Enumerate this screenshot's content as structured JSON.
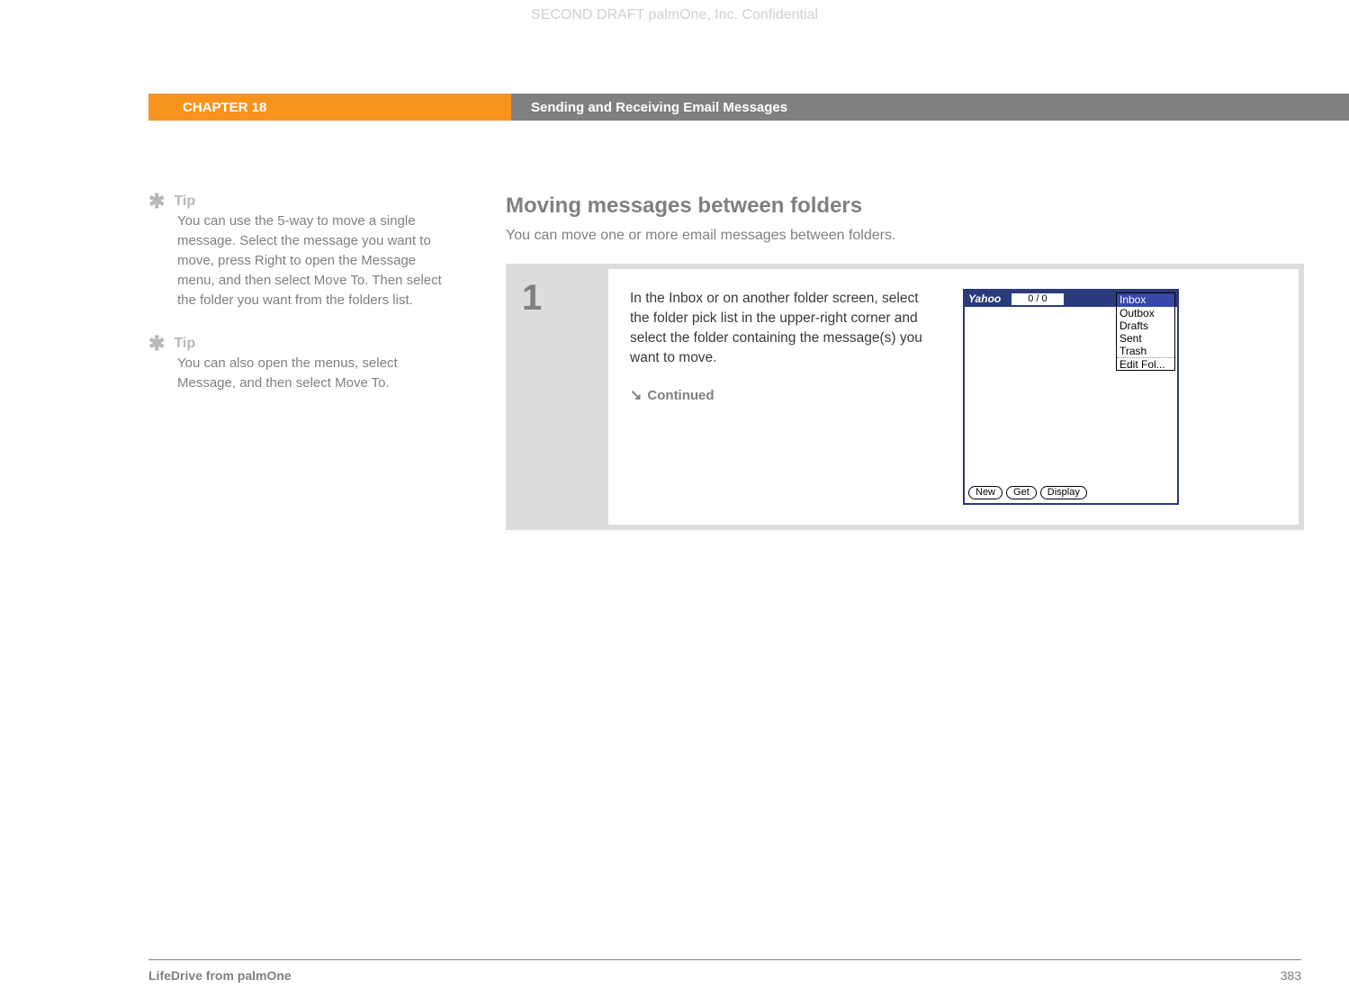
{
  "watermark": "SECOND DRAFT palmOne, Inc.  Confidential",
  "header": {
    "chapter": "CHAPTER 18",
    "title": "Sending and Receiving Email Messages"
  },
  "tips": [
    {
      "label": "Tip",
      "body": "You can use the 5-way to move a single message. Select the message you want to move, press Right to open the Message menu, and then select Move To. Then select the folder you want from the folders list."
    },
    {
      "label": "Tip",
      "body": "You can also open the menus, select Message, and then select Move To."
    }
  ],
  "main": {
    "section_title": "Moving messages between folders",
    "section_intro": "You can move one or more email messages between folders.",
    "step": {
      "number": "1",
      "text": "In the Inbox or on another folder screen, select the folder pick list in the upper-right corner and select the folder containing the message(s) you want to move.",
      "continued": "Continued"
    }
  },
  "screenshot": {
    "brand": "Yahoo",
    "counter": "0 / 0",
    "dropdown": {
      "selected": "Inbox",
      "items": [
        "Outbox",
        "Drafts",
        "Sent",
        "Trash",
        "Edit Fol..."
      ]
    },
    "buttons": [
      "New",
      "Get",
      "Display"
    ]
  },
  "footer": {
    "left": "LifeDrive from palmOne",
    "right": "383"
  }
}
